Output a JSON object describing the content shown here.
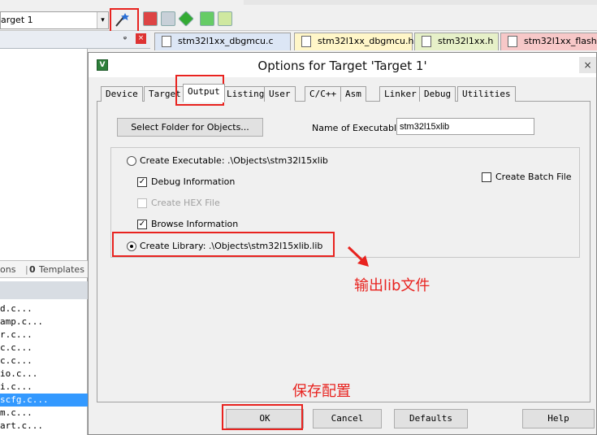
{
  "toolbar": {
    "target_value": "arget 1",
    "combo_arrow": "▾"
  },
  "left_panel": {
    "pin_glyph": "ᵩ",
    "close_glyph": "×",
    "tab_functions": "ons",
    "tab_templates": "Templates",
    "files": [
      "d.c...",
      "amp.c...",
      "r.c...",
      "c.c...",
      "c.c...",
      "io.c...",
      "i.c...",
      "scfg.c...",
      "m.c...",
      "art.c..."
    ],
    "selected_index": 7
  },
  "editor_tabs": [
    {
      "label": "stm32l1xx_dbgmcu.c",
      "bg": "#dce6f5"
    },
    {
      "label": "stm32l1xx_dbgmcu.h",
      "bg": "#fff6c8"
    },
    {
      "label": "stm32l1xx.h",
      "bg": "#e6f0c8"
    },
    {
      "label": "stm32l1xx_flash.c",
      "bg": "#f7c8c8"
    }
  ],
  "dialog": {
    "icon_letter": "V",
    "title": "Options for Target 'Target 1'",
    "close_glyph": "×",
    "tabs": [
      "Device",
      "Target",
      "Output",
      "Listing",
      "User",
      "C/C++",
      "Asm",
      "Linker",
      "Debug",
      "Utilities"
    ],
    "active_tab": "Output",
    "select_folder_label": "Select Folder for Objects...",
    "name_of_exec_label": "Name of Executable:",
    "name_of_exec_value": "stm32l15xlib",
    "create_exec_label": "Create Executable:  .\\Objects\\stm32l15xlib",
    "debug_info_label": "Debug Information",
    "create_hex_label": "Create HEX File",
    "browse_info_label": "Browse Information",
    "create_lib_label": "Create Library:  .\\Objects\\stm32l15xlib.lib",
    "create_batch_label": "Create Batch File",
    "ok_label": "OK",
    "cancel_label": "Cancel",
    "defaults_label": "Defaults",
    "help_label": "Help",
    "check_glyph": "✓"
  },
  "annotations": {
    "output_lib": "输出lib文件",
    "save_config": "保存配置"
  },
  "colors": {
    "annotation_red": "#e8231f",
    "selection_blue": "#3399ff"
  }
}
